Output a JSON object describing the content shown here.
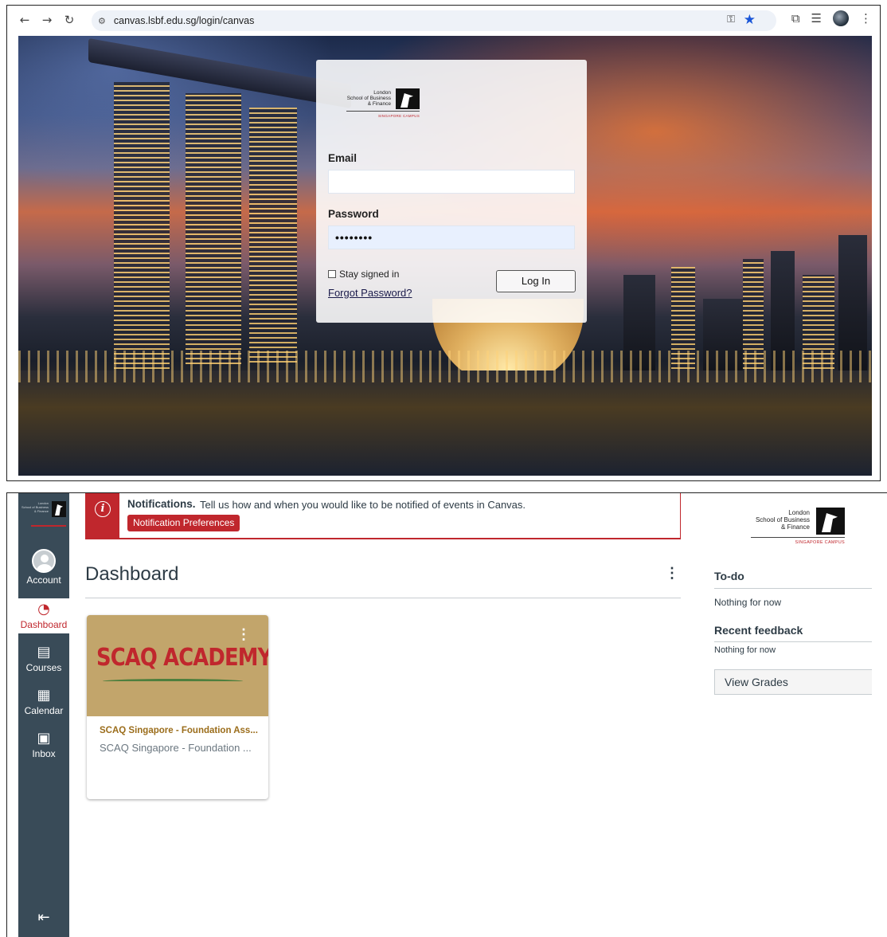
{
  "browser": {
    "url": "canvas.lsbf.edu.sg/login/canvas",
    "bookmark_starred": true
  },
  "login": {
    "brand": {
      "line1": "London",
      "line2": "School of Business",
      "line3": "& Finance",
      "campus": "SINGAPORE CAMPUS"
    },
    "email_label": "Email",
    "email_value": "",
    "password_label": "Password",
    "password_value": "••••••••",
    "stay_signed_in_label": "Stay signed in",
    "stay_signed_in_checked": false,
    "forgot_password": "Forgot Password?",
    "login_button": "Log In"
  },
  "global_nav": {
    "items": [
      {
        "label": "Account",
        "icon": "avatar-icon"
      },
      {
        "label": "Dashboard",
        "icon": "dashboard-gauge-icon",
        "active": true
      },
      {
        "label": "Courses",
        "icon": "book-icon"
      },
      {
        "label": "Calendar",
        "icon": "calendar-icon"
      },
      {
        "label": "Inbox",
        "icon": "inbox-icon"
      }
    ],
    "collapse_icon": "collapse-left-icon",
    "active_color": "#c0272d",
    "bg_color": "#394b58"
  },
  "notification": {
    "title": "Notifications.",
    "text": "Tell us how and when you would like to be notified of events in Canvas.",
    "button": "Notification Preferences",
    "icon": "info-icon",
    "accent": "#c0272d"
  },
  "dashboard": {
    "title": "Dashboard",
    "card": {
      "image_text": "SCAQ ACADEMY",
      "name": "SCAQ Singapore - Foundation Ass...",
      "code": "SCAQ Singapore - Foundation ...",
      "name_color": "#9b6d1b"
    }
  },
  "right_sidebar": {
    "brand": {
      "line1": "London",
      "line2": "School of Business",
      "line3": "& Finance",
      "campus": "SINGAPORE CAMPUS"
    },
    "todo_heading": "To-do",
    "todo_empty": "Nothing for now",
    "feedback_heading": "Recent feedback",
    "feedback_empty": "Nothing for now",
    "view_grades": "View Grades"
  }
}
